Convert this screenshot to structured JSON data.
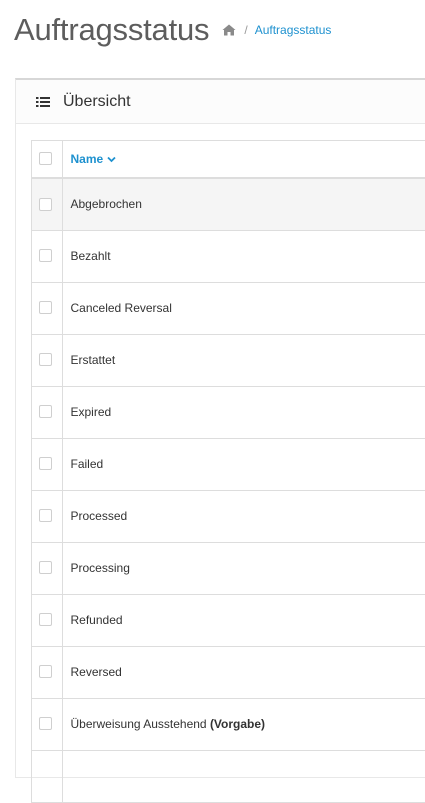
{
  "page": {
    "title": "Auftragsstatus",
    "breadcrumb": {
      "home_icon": "home-icon",
      "separator": "/",
      "current": "Auftragsstatus"
    }
  },
  "panel": {
    "icon": "list-icon",
    "title": "Übersicht"
  },
  "table": {
    "columns": [
      {
        "label": "Name",
        "sort": "ascending",
        "sort_icon": "caret-down-icon"
      }
    ],
    "rows": [
      {
        "name": "Abgebrochen",
        "default_label": ""
      },
      {
        "name": "Bezahlt",
        "default_label": ""
      },
      {
        "name": "Canceled Reversal",
        "default_label": ""
      },
      {
        "name": "Erstattet",
        "default_label": ""
      },
      {
        "name": "Expired",
        "default_label": ""
      },
      {
        "name": "Failed",
        "default_label": ""
      },
      {
        "name": "Processed",
        "default_label": ""
      },
      {
        "name": "Processing",
        "default_label": ""
      },
      {
        "name": "Refunded",
        "default_label": ""
      },
      {
        "name": "Reversed",
        "default_label": ""
      },
      {
        "name": "Überweisung Ausstehend",
        "default_label": "(Vorgabe)"
      }
    ]
  },
  "colors": {
    "link": "#1e91cf",
    "title": "#5d5d5d",
    "border": "#dddddd",
    "row_hover": "#f5f5f5"
  }
}
